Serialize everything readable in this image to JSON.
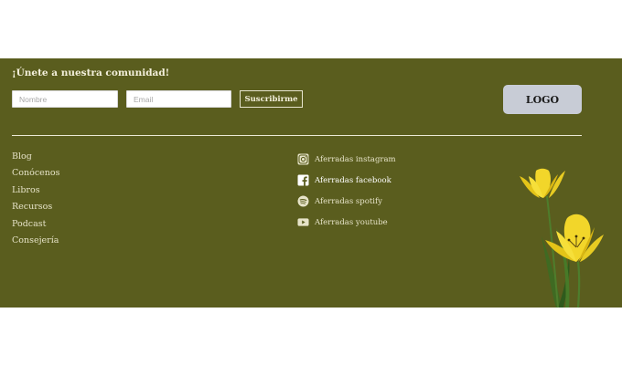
{
  "newsletter": {
    "title": "¡Únete a nuestra comunidad!",
    "name_placeholder": "Nombre",
    "email_placeholder": "Email",
    "subscribe_label": "Suscribirme"
  },
  "logo": {
    "label": "LOGO"
  },
  "nav": {
    "items": [
      {
        "label": "Blog"
      },
      {
        "label": "Conócenos"
      },
      {
        "label": "Libros"
      },
      {
        "label": "Recursos"
      },
      {
        "label": "Podcast"
      },
      {
        "label": "Consejería"
      }
    ]
  },
  "social": {
    "items": [
      {
        "label": "Aferradas instagram",
        "icon": "instagram-icon"
      },
      {
        "label": "Aferradas facebook",
        "icon": "facebook-icon"
      },
      {
        "label": "Aferradas spotify",
        "icon": "spotify-icon"
      },
      {
        "label": "Aferradas youtube",
        "icon": "youtube-icon"
      }
    ]
  },
  "colors": {
    "footer_bg": "#5a5d1e",
    "text": "#e6e3c8",
    "logo_bg": "#c8ccd6",
    "flower": "#f2d62a"
  }
}
